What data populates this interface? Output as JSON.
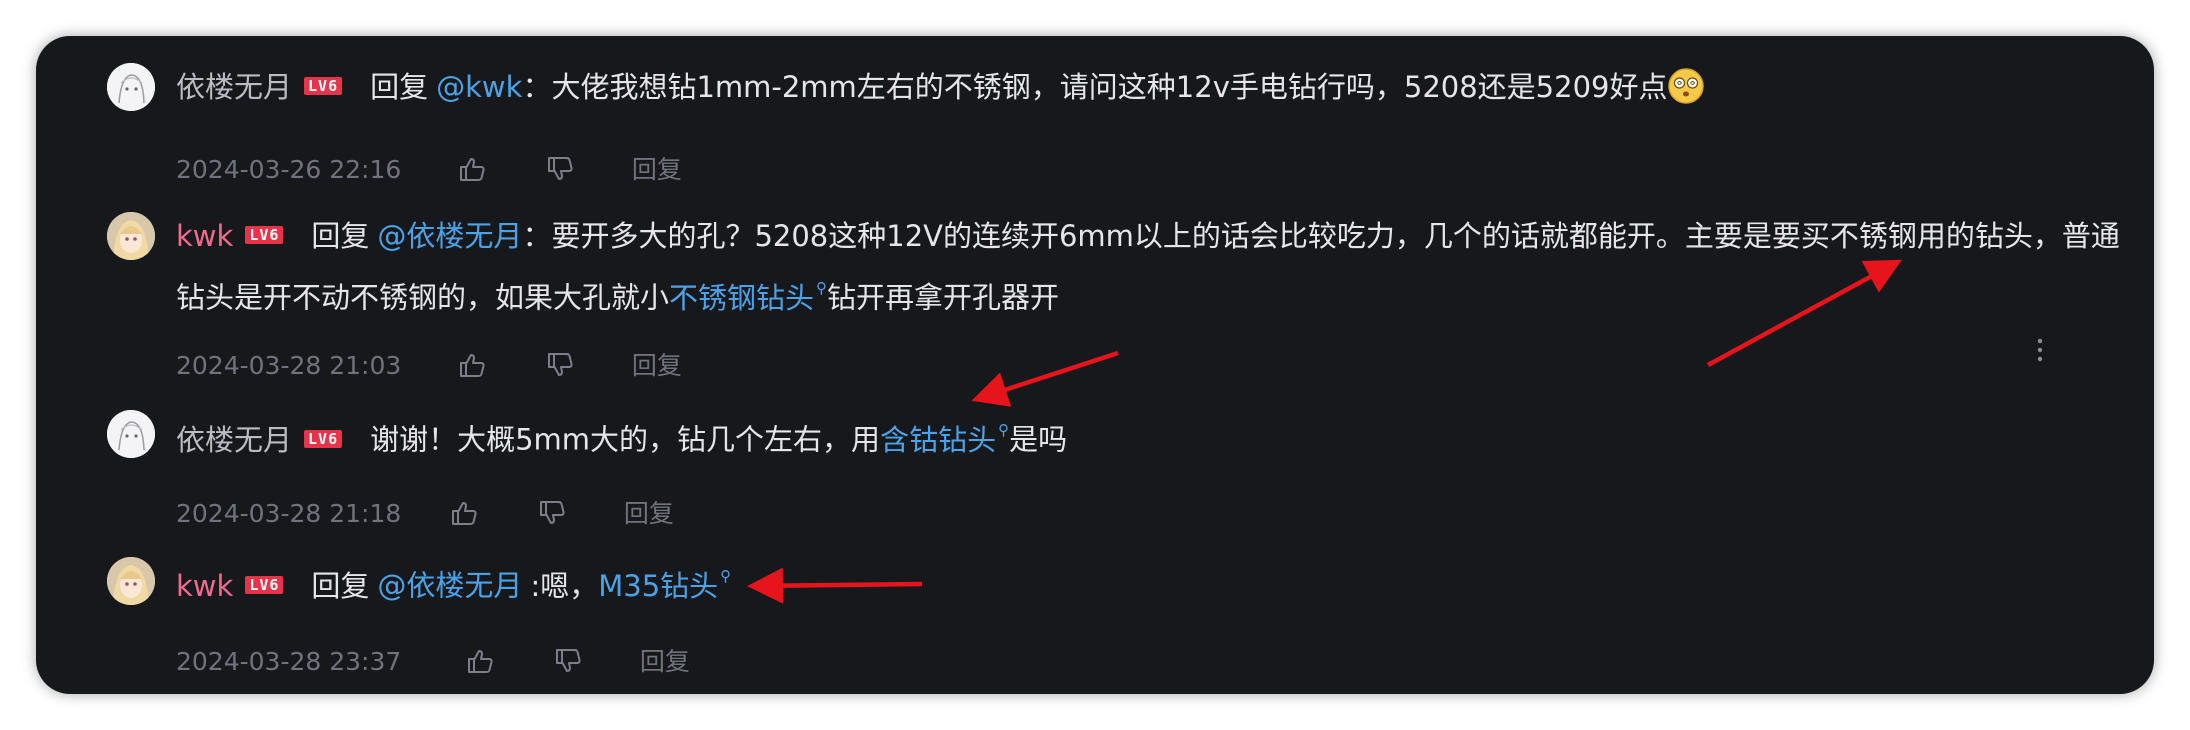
{
  "comments": [
    {
      "username": "依楼无月",
      "level": "LV6",
      "reply_word": "回复",
      "mention": "@kwk",
      "text": "：大佬我想钻1mm-2mm左右的不锈钢，请问这种12v手电钻行吗，5208还是5209好点",
      "emoji": "dizzy-face-emoji",
      "time": "2024-03-26 22:16",
      "reply_label": "回复"
    },
    {
      "username": "kwk",
      "level": "LV6",
      "reply_word": "回复",
      "mention": "@依楼无月",
      "text_before": "：要开多大的孔？5208这种12V的连续开6mm以上的话会比较吃力，几个的话就都能开。主要是要买不锈钢用的钻头，普通钻头是开不动不锈钢的，如果大孔就小",
      "link": "不锈钢钻头",
      "text_after": "钻开再拿开孔器开",
      "time": "2024-03-28 21:03",
      "reply_label": "回复"
    },
    {
      "username": "依楼无月",
      "level": "LV6",
      "text_before": "谢谢！大概5mm大的，钻几个左右，用",
      "link": "含钴钻头",
      "text_after": "是吗",
      "time": "2024-03-28 21:18",
      "reply_label": "回复"
    },
    {
      "username": "kwk",
      "level": "LV6",
      "reply_word": "回复",
      "mention": "@依楼无月",
      "text_before": ":嗯，",
      "link": "M35钻头",
      "time": "2024-03-28 23:37",
      "reply_label": "回复"
    }
  ],
  "icons": {
    "like": "thumbs-up-icon",
    "dislike": "thumbs-down-icon",
    "search_link": "search-link-icon",
    "more": "more-vertical-icon"
  },
  "colors": {
    "background": "#17181c",
    "link": "#4aa3e8",
    "pink_username": "#f26a8d",
    "badge": "#e8334a",
    "annotation_arrow": "#e8141c"
  }
}
